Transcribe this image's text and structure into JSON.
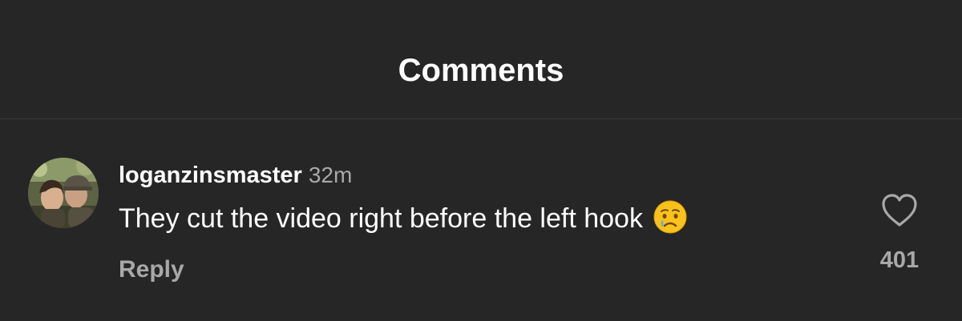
{
  "header": {
    "title": "Comments"
  },
  "comment": {
    "username": "loganzinsmaster",
    "timestamp": "32m",
    "text": "They cut the video right before the left hook",
    "emoji": "crying-face-emoji",
    "reply_label": "Reply",
    "like_icon": "heart-outline-icon",
    "like_count": "401"
  },
  "colors": {
    "background": "#262626",
    "primary_text": "#ffffff",
    "secondary_text": "#a8a8a8",
    "divider": "#3a3a3a"
  }
}
